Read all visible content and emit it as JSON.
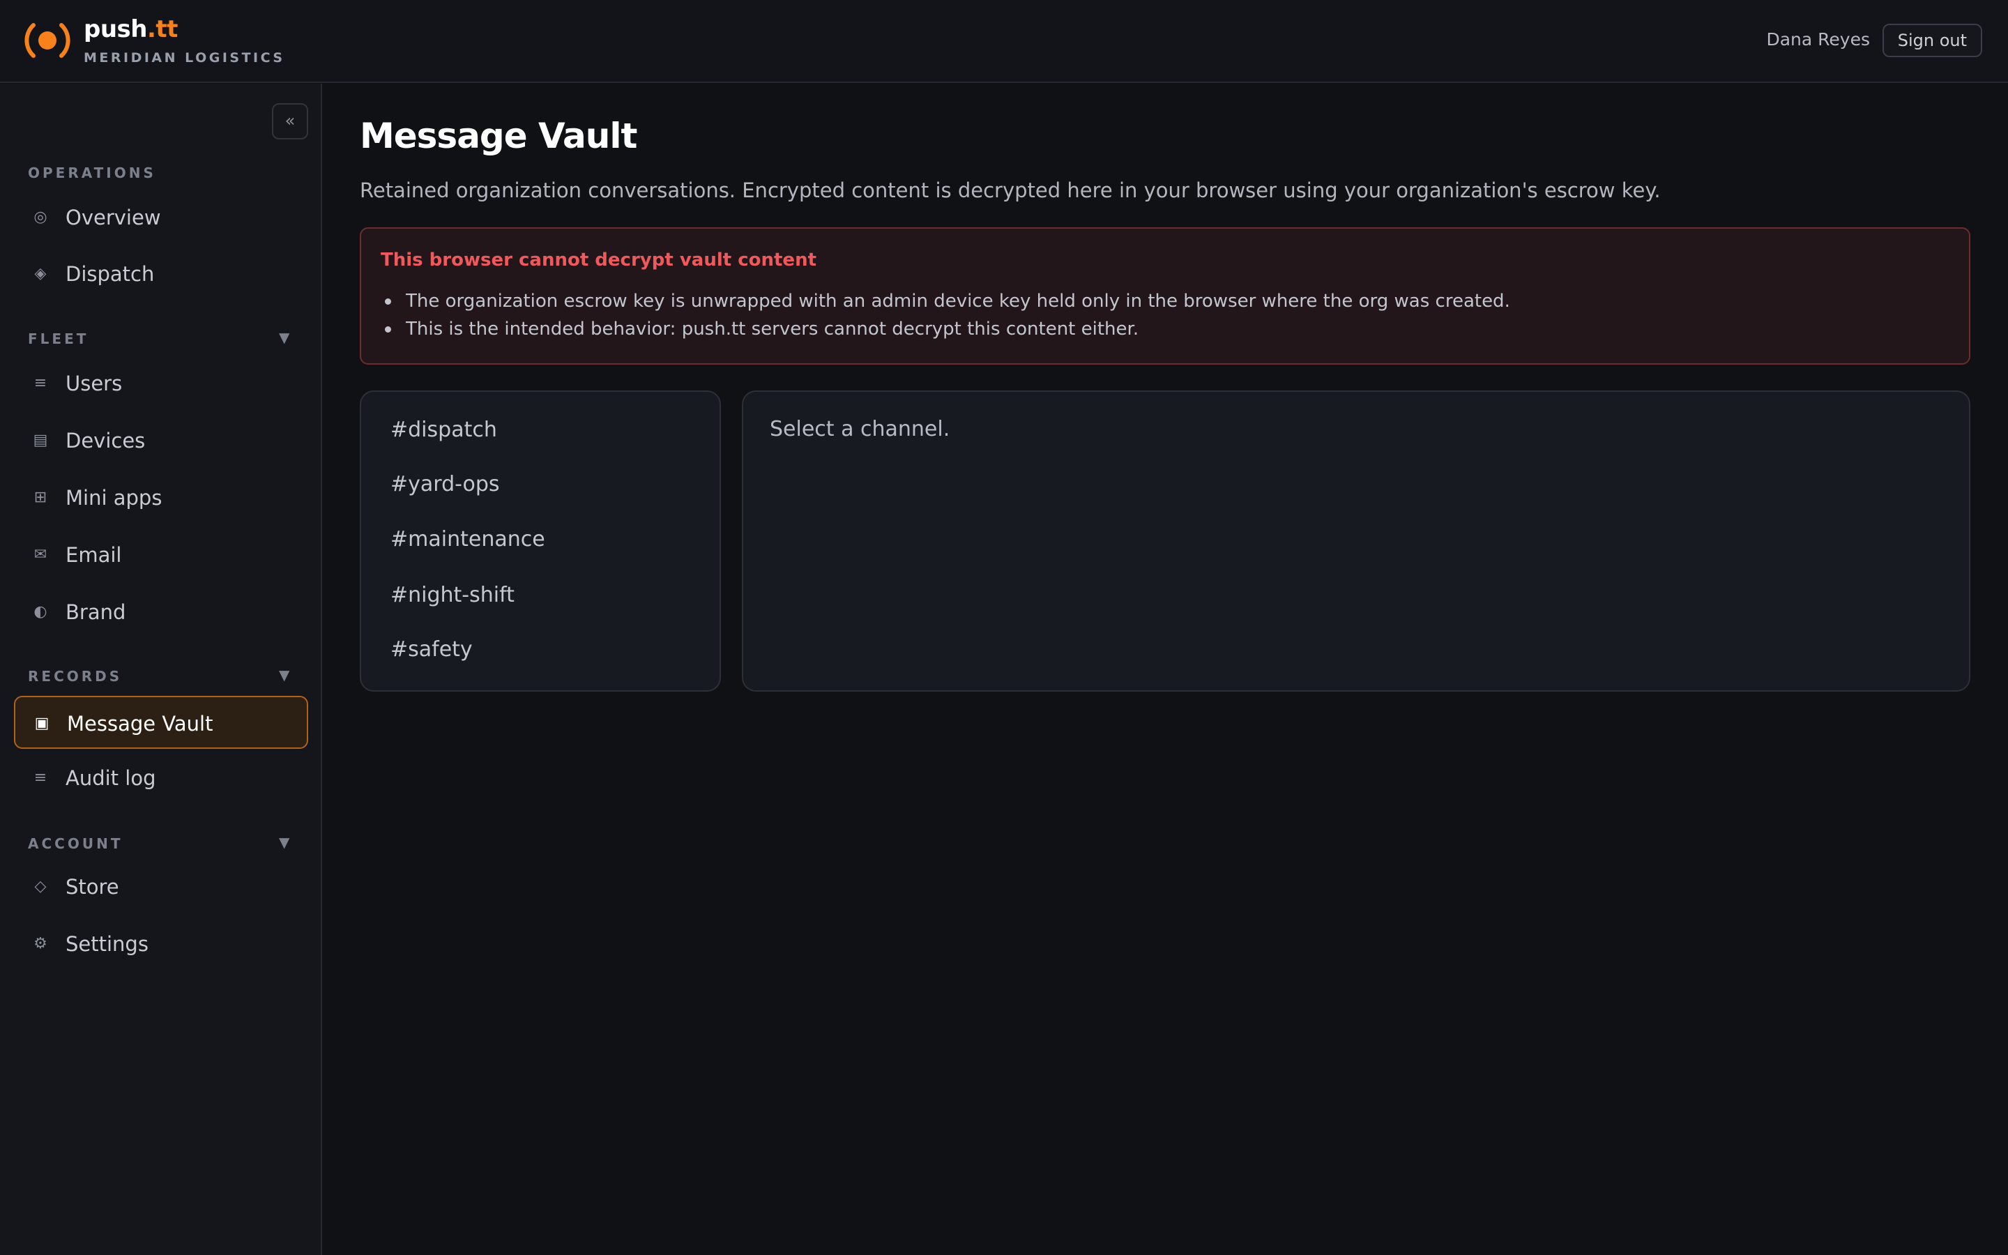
{
  "header": {
    "brand_name": "push",
    "brand_suffix": ".tt",
    "org_name": "MERIDIAN LOGISTICS",
    "user_name": "Dana Reyes",
    "signout_label": "Sign out",
    "accent_color": "#f7821b"
  },
  "sidebar": {
    "collapse_icon": "«",
    "sections": {
      "operations": "OPERATIONS",
      "fleet": "FLEET",
      "records": "RECORDS",
      "account": "ACCOUNT"
    },
    "caret": "▼",
    "items": [
      {
        "label": "Overview",
        "icon": "◎",
        "icon_name": "overview-icon"
      },
      {
        "label": "Dispatch",
        "icon": "◈",
        "icon_name": "dispatch-icon"
      },
      {
        "label": "Users",
        "icon": "≡",
        "icon_name": "users-icon"
      },
      {
        "label": "Devices",
        "icon": "▤",
        "icon_name": "devices-icon"
      },
      {
        "label": "Mini apps",
        "icon": "⊞",
        "icon_name": "mini-apps-icon"
      },
      {
        "label": "Email",
        "icon": "✉",
        "icon_name": "email-icon"
      },
      {
        "label": "Brand",
        "icon": "◐",
        "icon_name": "brand-icon"
      },
      {
        "label": "Message Vault",
        "icon": "▣",
        "icon_name": "vault-icon",
        "active": true
      },
      {
        "label": "Audit log",
        "icon": "≡",
        "icon_name": "audit-log-icon"
      },
      {
        "label": "Store",
        "icon": "◇",
        "icon_name": "store-icon"
      },
      {
        "label": "Settings",
        "icon": "⚙",
        "icon_name": "settings-icon"
      }
    ]
  },
  "main": {
    "title": "Message Vault",
    "description": "Retained organization conversations. Encrypted content is decrypted here in your browser using your organization's escrow key.",
    "alert": {
      "title": "This browser cannot decrypt vault content",
      "points": [
        "The organization escrow key is unwrapped with an admin device key held only in the browser where the org was created.",
        "This is the intended behavior: push.tt servers cannot decrypt this content either."
      ]
    },
    "channels": [
      "#dispatch",
      "#yard-ops",
      "#maintenance",
      "#night-shift",
      "#safety"
    ],
    "empty_message": "Select a channel."
  }
}
